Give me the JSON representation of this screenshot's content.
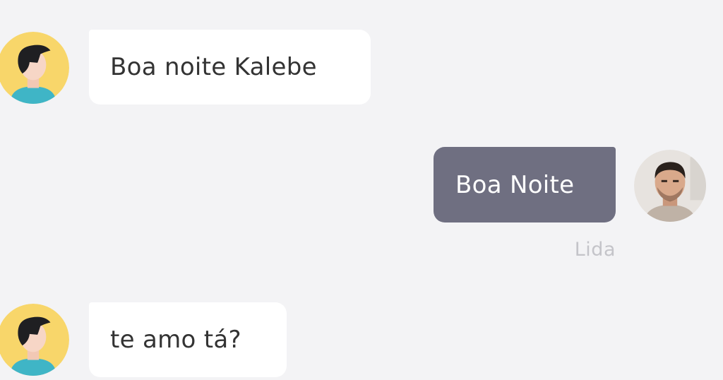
{
  "conversation": {
    "messages": [
      {
        "direction": "incoming",
        "text": "Boa noite Kalebe"
      },
      {
        "direction": "outgoing",
        "text": "Boa Noite",
        "status": "Lida"
      },
      {
        "direction": "incoming",
        "text": "te amo tá?"
      }
    ]
  },
  "icons": {
    "contact_avatar": "cartoon-person-avatar-icon",
    "user_avatar": "user-profile-photo"
  },
  "colors": {
    "background": "#f3f3f5",
    "incoming_bubble": "#ffffff",
    "outgoing_bubble": "#6f6f81",
    "avatar_bg": "#f8d66a"
  }
}
